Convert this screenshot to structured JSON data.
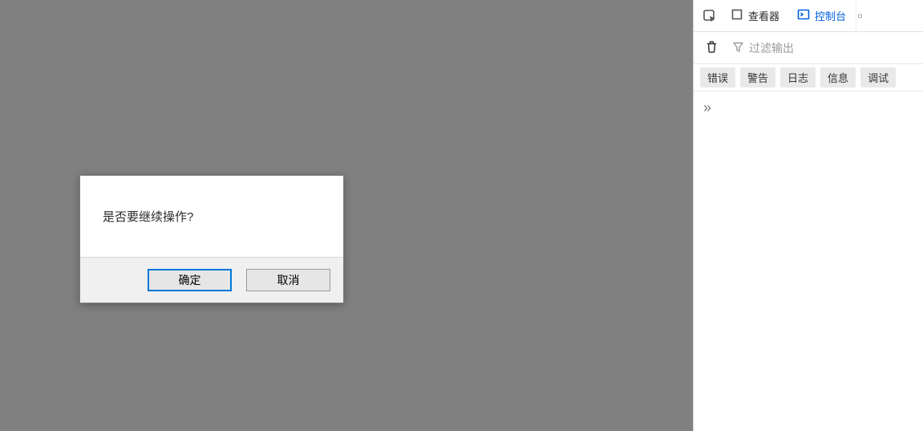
{
  "dialog": {
    "message": "是否要继续操作?",
    "ok_label": "确定",
    "cancel_label": "取消"
  },
  "devtools": {
    "tabs": {
      "inspector": "查看器",
      "console": "控制台"
    },
    "filter": {
      "placeholder": "过滤输出"
    },
    "levels": {
      "error": "错误",
      "warn": "警告",
      "log": "日志",
      "info": "信息",
      "debug": "调试"
    },
    "expand_glyph": "»"
  }
}
